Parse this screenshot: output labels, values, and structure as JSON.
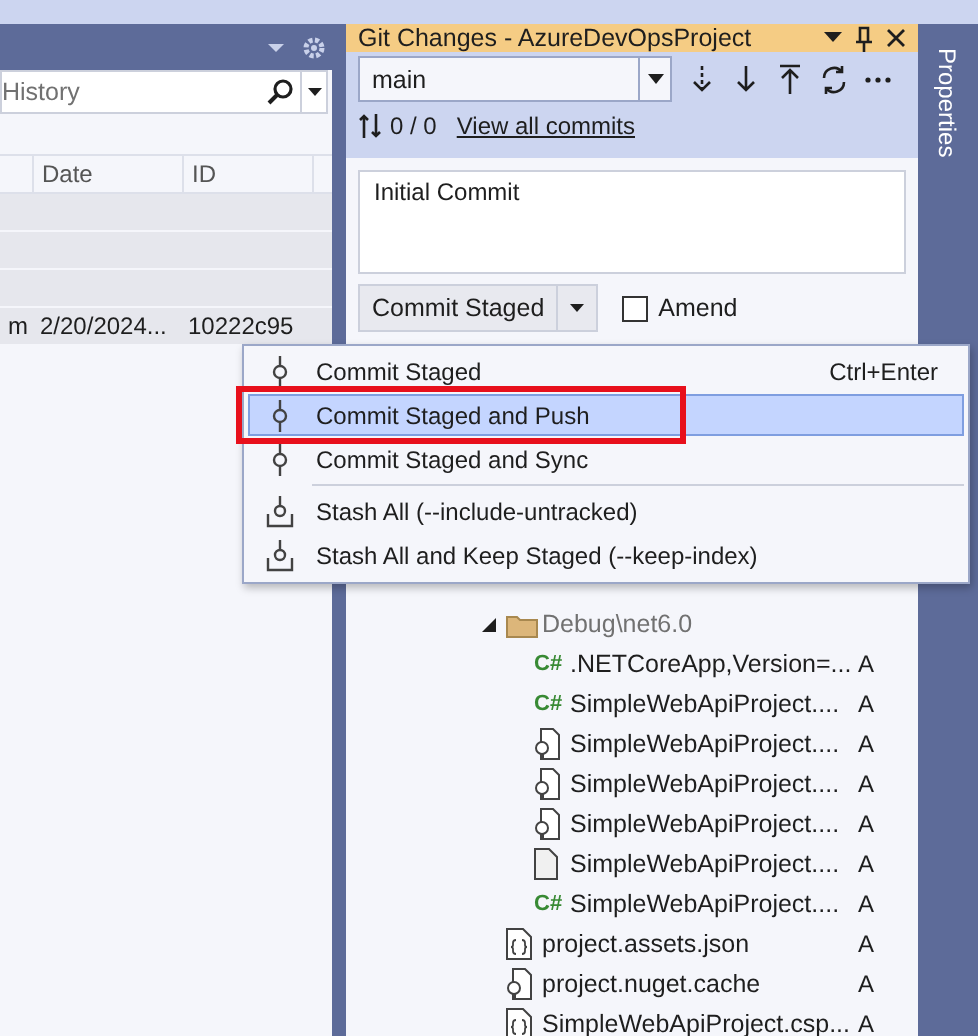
{
  "history_panel": {
    "search": {
      "value": "History"
    },
    "columns": [
      "Date",
      "ID"
    ],
    "rows": [
      {
        "column_1": "",
        "date": "",
        "id": ""
      },
      {
        "column_1": "",
        "date": "",
        "id": ""
      },
      {
        "column_1": "",
        "date": "",
        "id": ""
      },
      {
        "column_1": "m",
        "date": "2/20/2024...",
        "id": "10222c95"
      }
    ]
  },
  "git_changes": {
    "title": "Git Changes - AzureDevOpsProject",
    "branch": "main",
    "counts": "0 / 0",
    "link": "View all commits",
    "message": "Initial Commit",
    "commit_button": "Commit Staged",
    "amend": {
      "label": "Amend",
      "checked": false
    },
    "tree": [
      {
        "kind": "folder",
        "name": "Debug\\net6.0",
        "expanded": true,
        "children": [
          {
            "kind": "csharp",
            "badge": "C#",
            "name": ".NETCoreApp,Version=...",
            "status": "A"
          },
          {
            "kind": "csharp",
            "badge": "C#",
            "name": "SimpleWebApiProject....",
            "status": "A"
          },
          {
            "kind": "config",
            "name": "SimpleWebApiProject....",
            "status": "A"
          },
          {
            "kind": "config",
            "name": "SimpleWebApiProject....",
            "status": "A"
          },
          {
            "kind": "config",
            "name": "SimpleWebApiProject....",
            "status": "A"
          },
          {
            "kind": "file",
            "name": "SimpleWebApiProject....",
            "status": "A"
          },
          {
            "kind": "csharp",
            "badge": "C#",
            "name": "SimpleWebApiProject....",
            "status": "A"
          }
        ]
      },
      {
        "kind": "json",
        "name": "project.assets.json",
        "status": "A"
      },
      {
        "kind": "config",
        "name": "project.nuget.cache",
        "status": "A"
      },
      {
        "kind": "json",
        "name": "SimpleWebApiProject.csp...",
        "status": "A"
      }
    ]
  },
  "menu": {
    "items": [
      {
        "kind": "commit",
        "label": "Commit Staged",
        "shortcut": "Ctrl+Enter",
        "selected": false
      },
      {
        "kind": "commit",
        "label": "Commit Staged and Push",
        "selected": true,
        "outlined": true
      },
      {
        "kind": "commit",
        "label": "Commit Staged and Sync",
        "selected": false
      },
      {
        "kind": "separator"
      },
      {
        "kind": "stash",
        "label": "Stash All (--include-untracked)",
        "selected": false
      },
      {
        "kind": "stash",
        "label": "Stash All and Keep Staged (--keep-index)",
        "selected": false
      }
    ]
  },
  "side_tab": {
    "label": "Properties"
  }
}
